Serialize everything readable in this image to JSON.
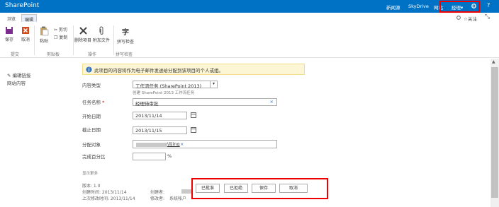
{
  "suite": {
    "brand": "SharePoint",
    "links": [
      "新闻源",
      "SkyDrive",
      "网站"
    ],
    "user": "经理",
    "user_caret": "▾",
    "settings_icon": "gear-icon",
    "help": "?"
  },
  "ribbon": {
    "tabs": [
      "浏览",
      "编辑"
    ],
    "active_tab": "编辑",
    "share_icon": "sync-icon",
    "follow": "关注",
    "focus_icon": "fullscreen-icon",
    "buttons": {
      "save": "保存",
      "cancel": "取消",
      "paste": "粘贴",
      "cut": "剪切",
      "copy": "复制",
      "delete_item": "删除项目",
      "attach_file": "附加文件",
      "spelling": "拼写检查",
      "spelling_glyph": "字"
    },
    "groups": [
      "提交",
      "剪贴板",
      "操作",
      "拼写检查"
    ]
  },
  "leftnav": {
    "edit_links": "编辑链接",
    "site_contents": "网站内容"
  },
  "info": {
    "message": "此项目的内容将作为电子邮件发送给分配到该项目的个人或组。"
  },
  "form": {
    "content_type_label": "内容类型",
    "content_type_value": "工作流任务 (SharePoint 2013)",
    "content_type_desc": "创建 SharePoint 2013 工作流任务",
    "task_name_label": "任务名称",
    "task_name_value": "经理待审批",
    "start_date_label": "开始日期",
    "start_date_value": "2013/11/14",
    "due_date_label": "截止日期",
    "due_date_value": "2013/11/15",
    "assigned_label": "分配对象",
    "assigned_value": "\\lijing",
    "percent_label": "完成百分比",
    "percent_unit": "%",
    "show_more": "显示更多"
  },
  "meta": {
    "version": "版本: 1.0",
    "created": "创建时间: 2013/11/14",
    "modified": "上次修改时间: 2013/11/14",
    "created_by": "创建者:",
    "modified_by": "修改者:",
    "system_account": "系统帐户"
  },
  "actions": {
    "approve": "已批准",
    "reject": "已拒绝",
    "save": "保存",
    "cancel": "取消"
  },
  "colors": {
    "suite_bar": "#0072c6",
    "highlight": "#ee0000",
    "info_bg": "#fdf6d4"
  }
}
